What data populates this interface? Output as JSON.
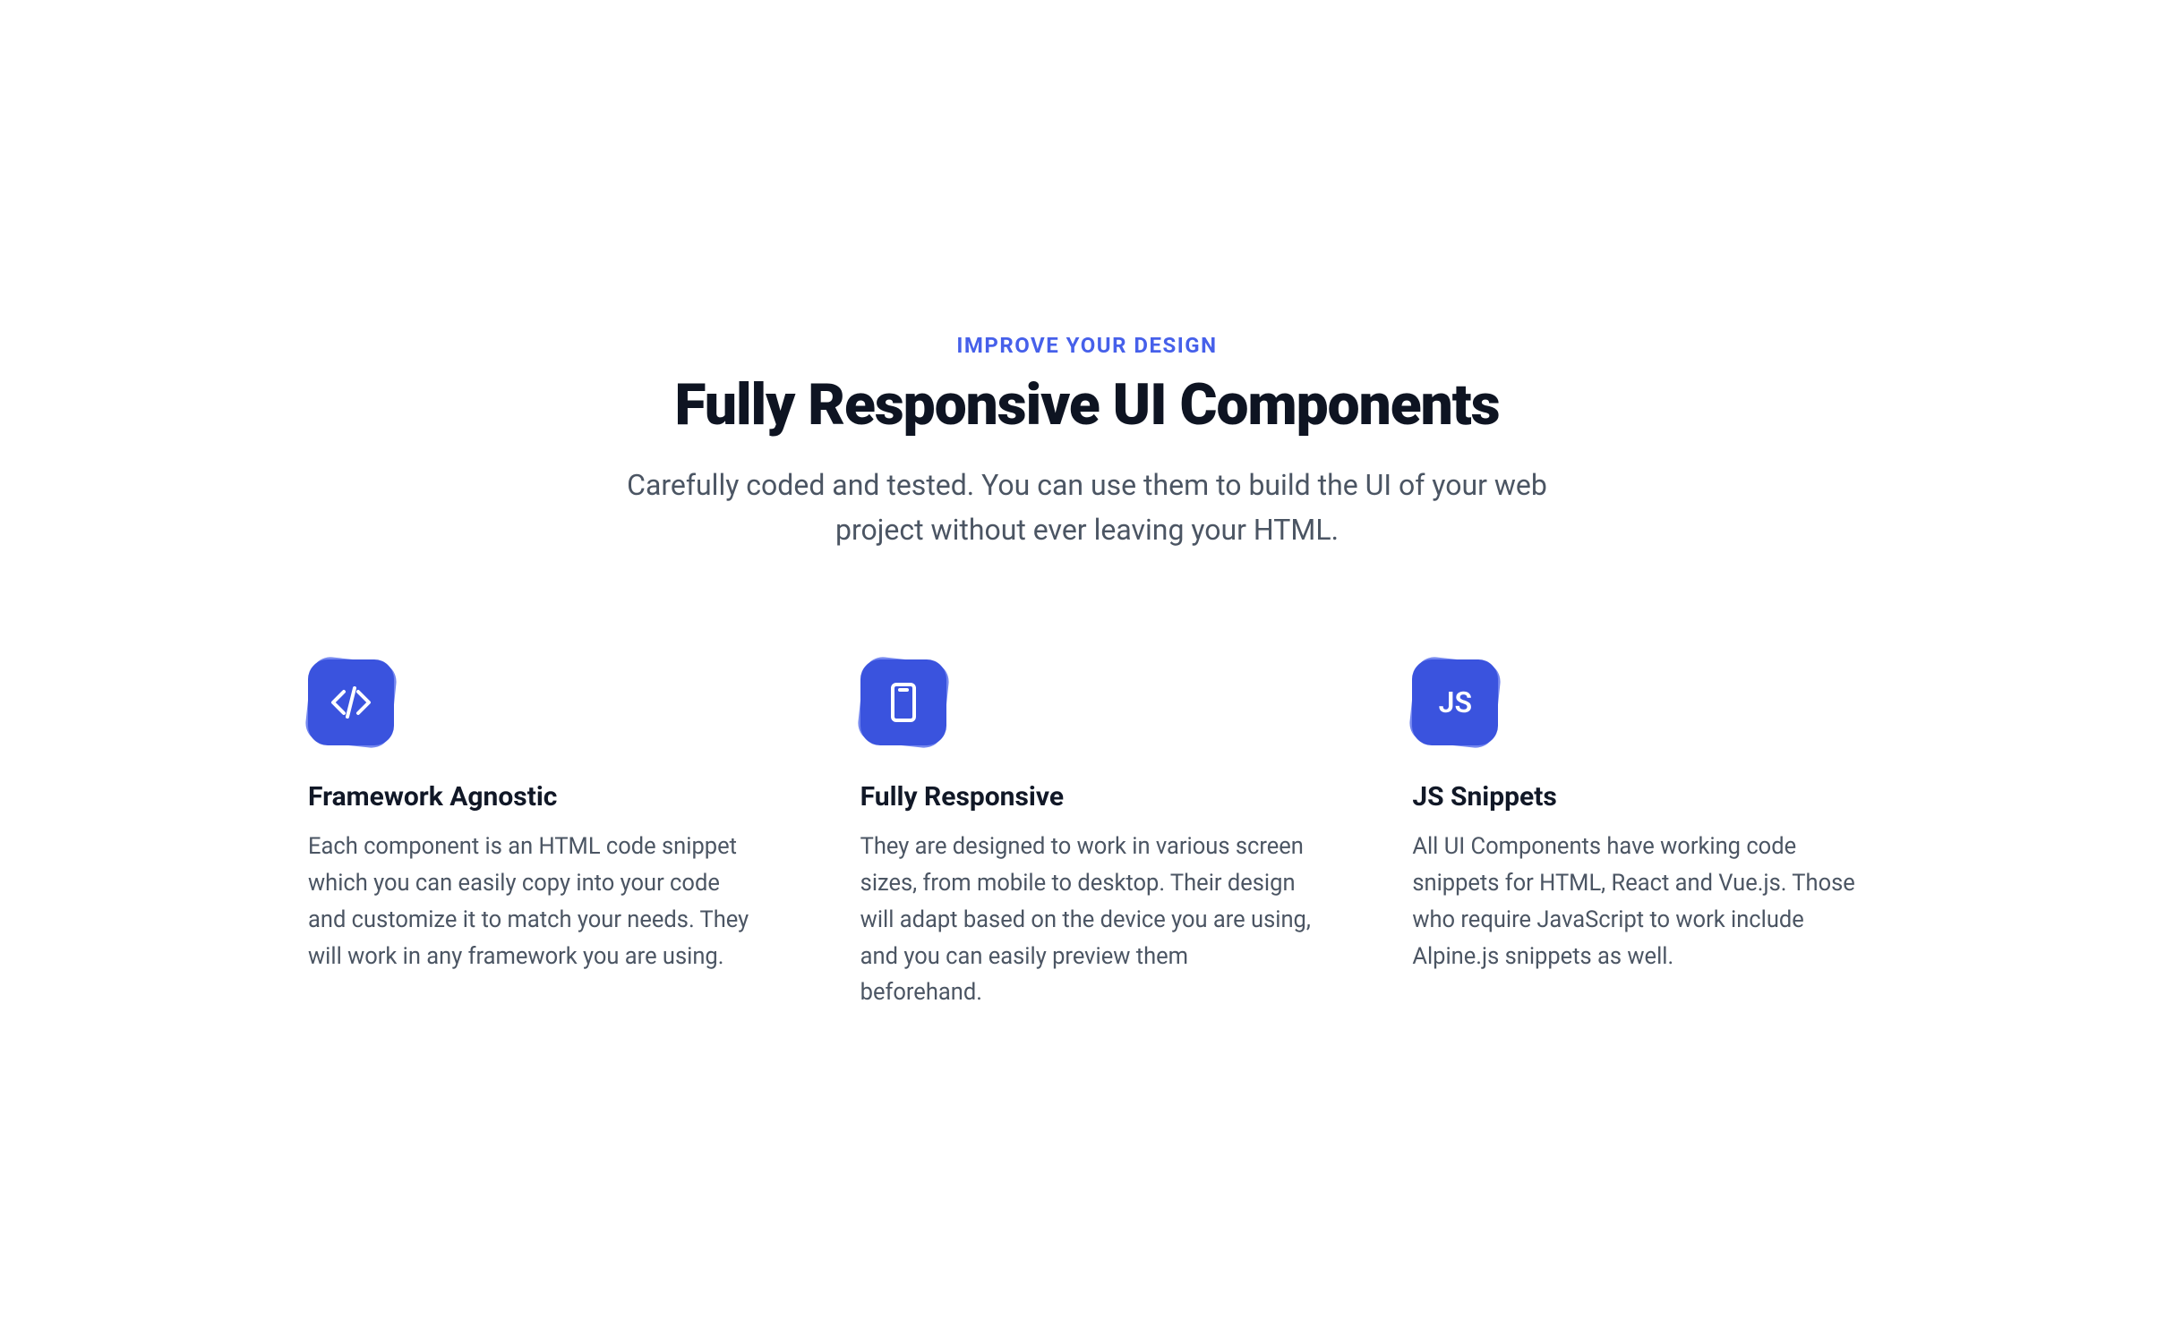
{
  "header": {
    "eyebrow": "IMPROVE YOUR DESIGN",
    "title": "Fully Responsive UI Components",
    "subtitle": "Carefully coded and tested. You can use them to build the UI of your web project without ever leaving your HTML."
  },
  "features": [
    {
      "icon": "code-icon",
      "title": "Framework Agnostic",
      "description": "Each component is an HTML code snippet which you can easily copy into your code and customize it to match your needs. They will work in any framework you are using."
    },
    {
      "icon": "phone-icon",
      "title": "Fully Responsive",
      "description": "They are designed to work in various screen sizes, from mobile to desktop. Their design will adapt based on the device you are using, and you can easily preview them beforehand."
    },
    {
      "icon": "js-icon",
      "title": "JS Snippets",
      "description": "All UI Components have working code snippets for HTML, React and Vue.js. Those who require JavaScript to work include Alpine.js snippets as well."
    }
  ]
}
